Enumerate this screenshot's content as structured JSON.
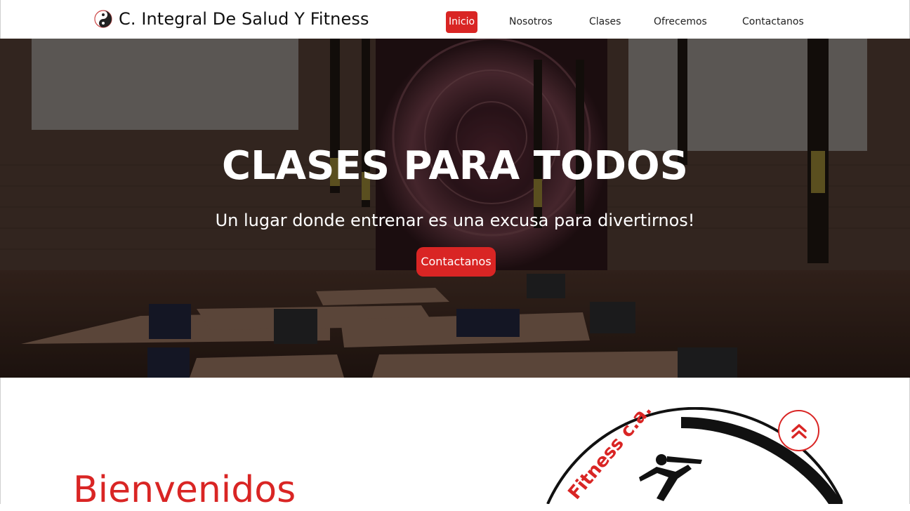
{
  "brand": {
    "title": "C. Integral De Salud Y Fitness",
    "logo_icon": "yin-yang-icon"
  },
  "nav": {
    "items": [
      {
        "label": "Inicio",
        "active": true
      },
      {
        "label": "Nosotros",
        "active": false
      },
      {
        "label": "Clases",
        "active": false
      },
      {
        "label": "Ofrecemos",
        "active": false
      },
      {
        "label": "Contactanos",
        "active": false
      }
    ]
  },
  "hero": {
    "title": "CLASES PARA TODOS",
    "subtitle": "Un lugar donde entrenar es una excusa para divertirnos!",
    "button_label": "Contactanos"
  },
  "welcome": {
    "heading": "Bienvenidos"
  },
  "logo_art": {
    "text": "Fitness c.a."
  },
  "scroll_top": {
    "icon": "double-chevron-up-icon"
  },
  "colors": {
    "accent": "#d92524",
    "hero_overlay": "#2b1d18"
  }
}
